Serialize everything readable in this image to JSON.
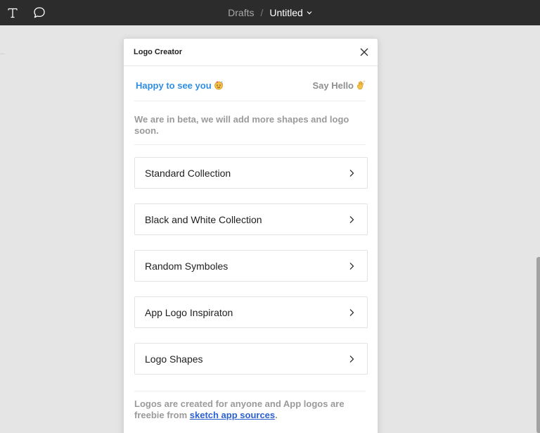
{
  "toolbar": {
    "text_tool_icon": "text-tool-icon",
    "comment_tool_icon": "comment-icon",
    "breadcrumb": {
      "location": "Drafts",
      "separator": "/",
      "file_name": "Untitled"
    }
  },
  "plugin": {
    "title": "Logo Creator",
    "greeting": {
      "left_text": "Happy to see you",
      "left_icon": "party-face-icon",
      "right_text": "Say Hello",
      "right_icon": "waving-hand-icon"
    },
    "beta_notice": "We are in beta, we will add more shapes and logo soon.",
    "menu_items": [
      {
        "label": "Standard Collection"
      },
      {
        "label": "Black and White Collection"
      },
      {
        "label": "Random Symboles"
      },
      {
        "label": "App Logo Inspiraton"
      },
      {
        "label": "Logo Shapes"
      }
    ],
    "footer": {
      "text_before": "Logos are created for anyone and App logos are freebie from ",
      "link_text": "sketch app sources",
      "text_after": "."
    }
  },
  "colors": {
    "toolbar_bg": "#2c2c2c",
    "canvas_bg": "#e5e5e5",
    "accent_blue": "#2f8de4",
    "link_blue": "#2b5fd0",
    "muted_text": "#9a9a9a"
  }
}
